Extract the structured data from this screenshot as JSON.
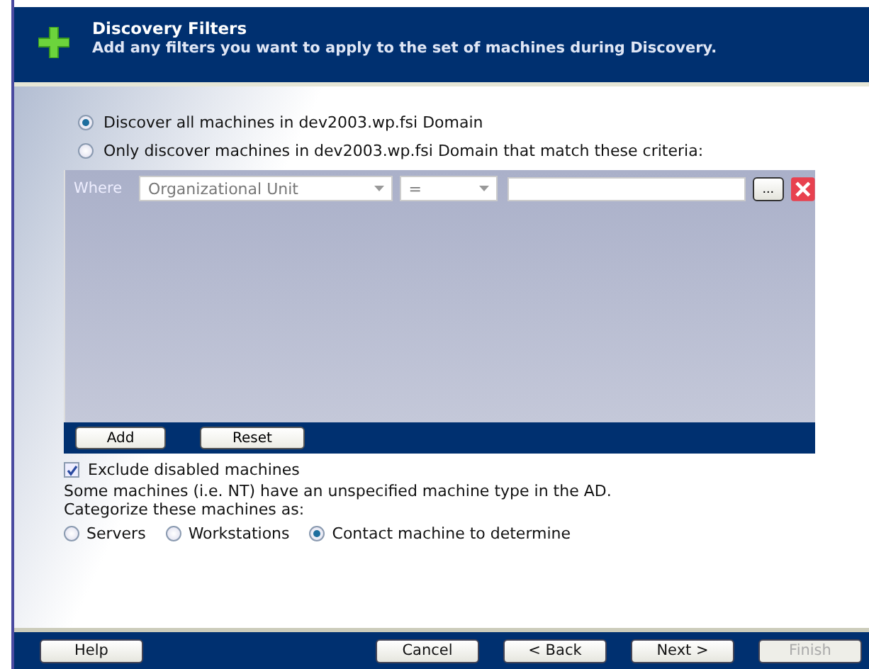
{
  "header": {
    "title": "Discovery Filters",
    "subtitle": "Add any filters you want to apply to the set of machines during Discovery."
  },
  "scope_options": [
    {
      "label": "Discover all machines in dev2003.wp.fsi Domain",
      "selected": true
    },
    {
      "label": "Only discover machines in dev2003.wp.fsi Domain that match these criteria:",
      "selected": false
    }
  ],
  "filter": {
    "where_label": "Where",
    "rows": [
      {
        "field": "Organizational Unit",
        "operator": "=",
        "browse": "..."
      }
    ],
    "buttons": [
      "Add",
      "Reset"
    ]
  },
  "exclude_disabled": {
    "label": "Exclude disabled machines",
    "checked": true
  },
  "note": [
    "Some machines (i.e. NT) have an unspecified machine type in the AD.",
    "Categorize these machines as:"
  ],
  "categorize_options": [
    {
      "label": "Servers",
      "selected": false
    },
    {
      "label": "Workstations",
      "selected": false
    },
    {
      "label": "Contact machine to determine",
      "selected": true
    }
  ],
  "footer_buttons": [
    {
      "label": "Help",
      "disabled": false,
      "kind": "left"
    },
    {
      "label": "Cancel",
      "disabled": false,
      "kind": "right"
    },
    {
      "label": "< Back",
      "disabled": false,
      "kind": "right"
    },
    {
      "label": "Next >",
      "disabled": false,
      "kind": "right"
    },
    {
      "label": "Finish",
      "disabled": true,
      "kind": "right"
    }
  ]
}
